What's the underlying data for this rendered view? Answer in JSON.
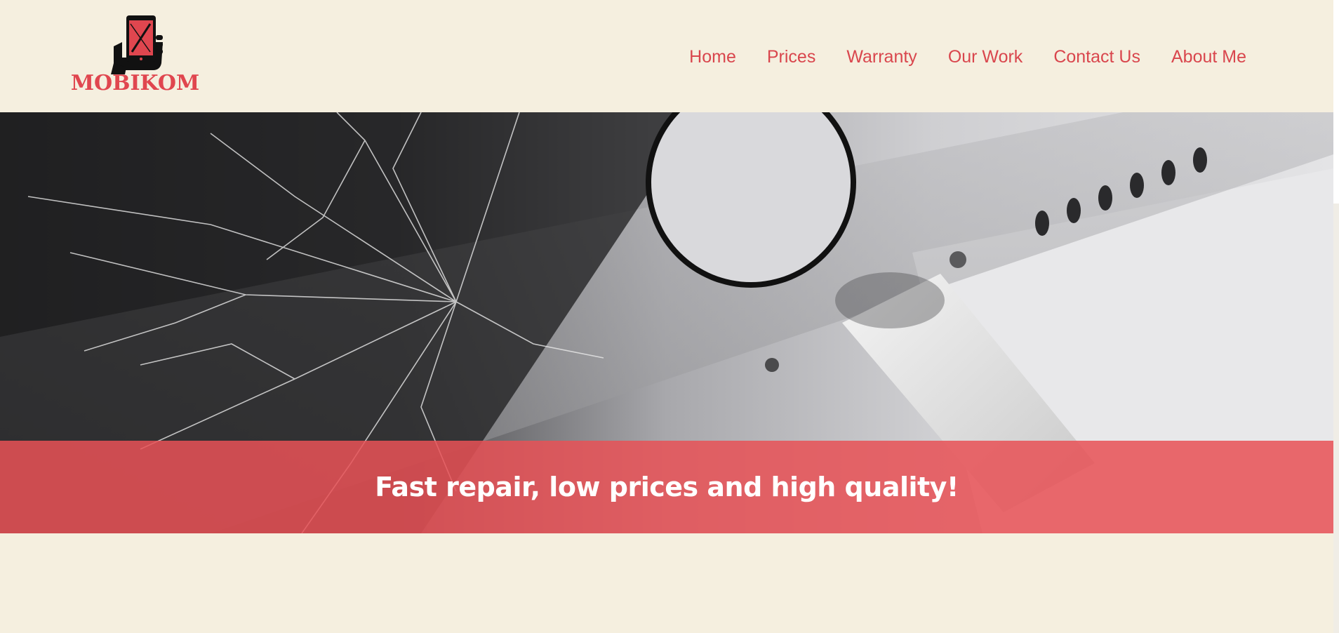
{
  "brand": {
    "name": "MOBIKOM",
    "logo_icon": "phone-in-hand-icon",
    "accent_color": "#e0464f"
  },
  "nav": {
    "items": [
      {
        "label": "Home"
      },
      {
        "label": "Prices"
      },
      {
        "label": "Warranty"
      },
      {
        "label": "Our Work"
      },
      {
        "label": "Contact Us"
      },
      {
        "label": "About Me"
      }
    ]
  },
  "hero": {
    "image": "cracked-phone-screen-with-charger",
    "banner_text": "Fast repair, low prices and high quality!",
    "banner_color": "#e85256"
  },
  "colors": {
    "background": "#f5efdf",
    "nav_text": "#d9464d"
  }
}
